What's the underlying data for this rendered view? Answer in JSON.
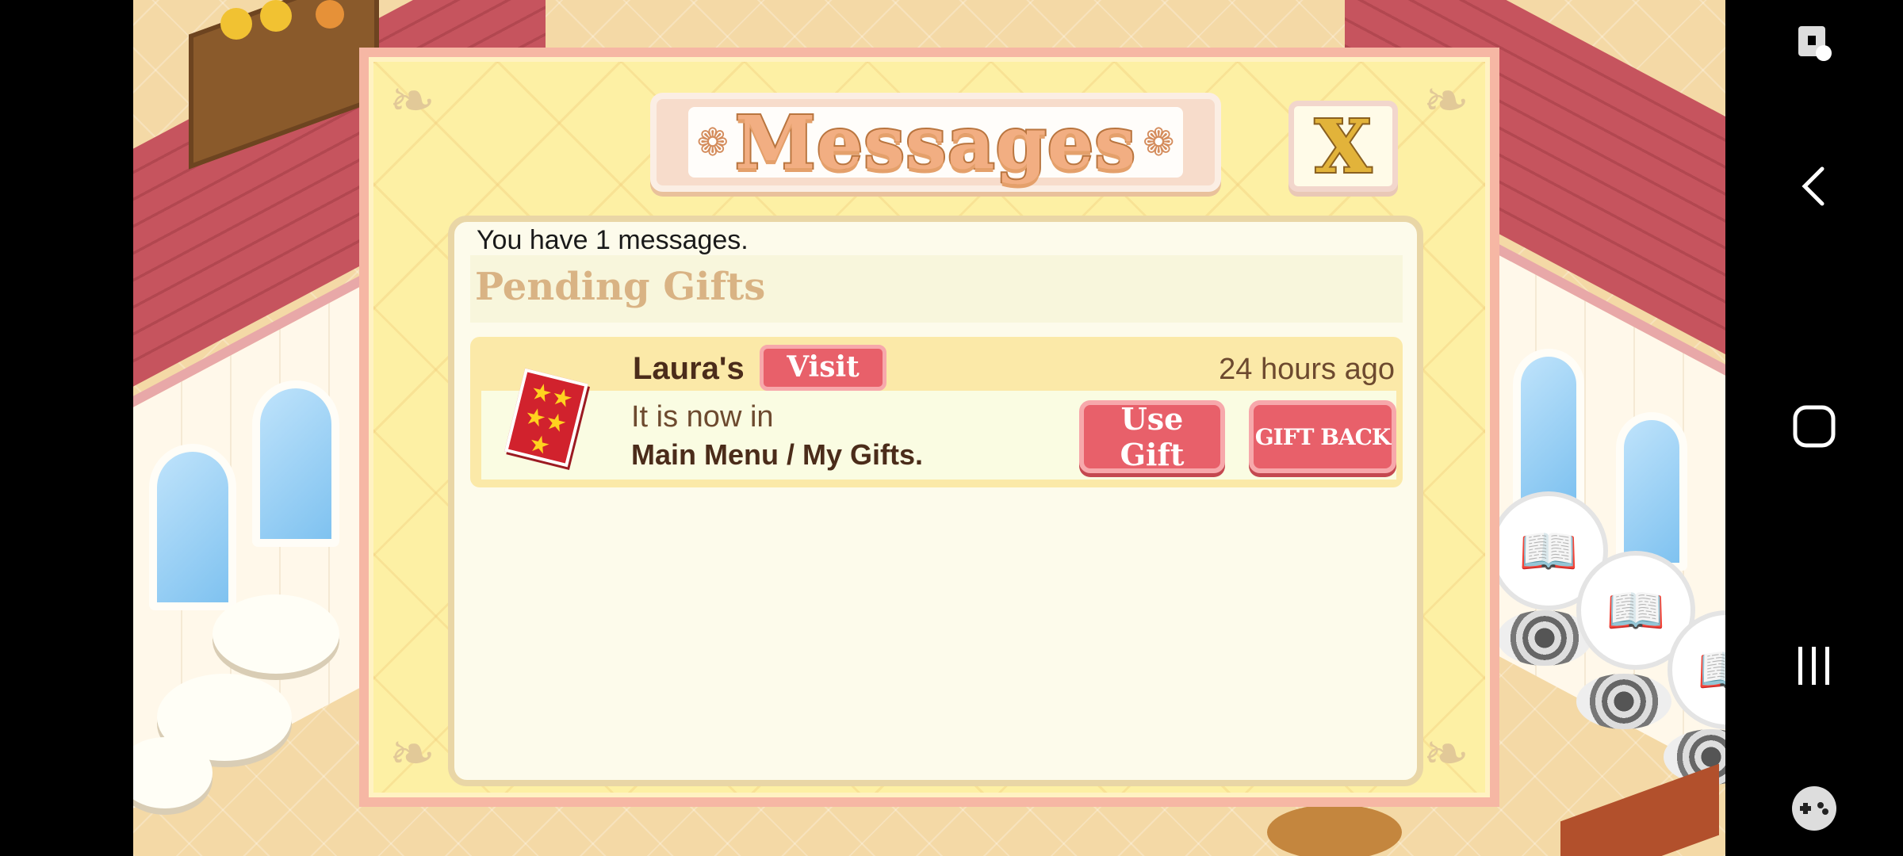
{
  "dialog": {
    "title": "Messages",
    "close_label": "X",
    "message_count": "You have 1 messages.",
    "section_title": "Pending Gifts",
    "gifts": [
      {
        "sender": "Laura's",
        "visit_label": "Visit",
        "time_ago": "24 hours ago",
        "line1": "It is now in",
        "line2": "Main Menu / My Gifts.",
        "use_label": "Use Gift",
        "gift_back_label": "GIFT BACK"
      }
    ]
  },
  "navbar": {
    "icons": [
      "screen-lock-icon",
      "back-icon",
      "home-icon",
      "recents-icon",
      "game-controller-icon"
    ]
  },
  "colors": {
    "dialog_bg": "#fdf0a4",
    "dialog_border": "#f6b7a4",
    "button_pink": "#e8606a",
    "title_orange": "#f2ae82"
  }
}
